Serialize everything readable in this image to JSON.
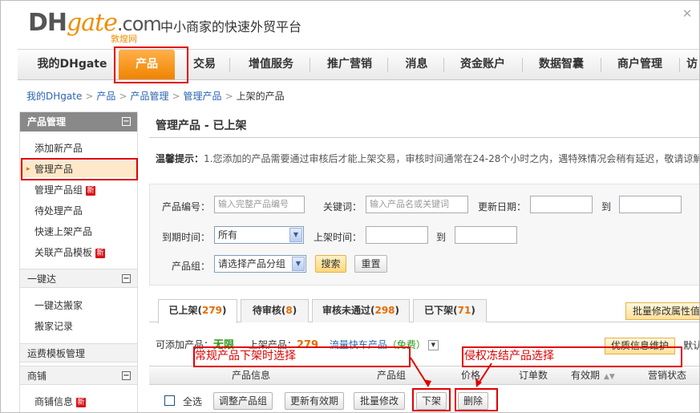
{
  "header": {
    "logo_dh": "DH",
    "logo_gate": "gate",
    "logo_com": ".com",
    "logo_sub": "敦煌网",
    "slogan": "中小商家的快速外贸平台",
    "close_symbol": "✕"
  },
  "nav": {
    "items": [
      "我的DHgate",
      "产品",
      "交易",
      "增值服务",
      "推广营销",
      "消息",
      "资金账户",
      "数据智囊",
      "商户管理",
      "访"
    ],
    "active_index": 1
  },
  "breadcrumb": {
    "items": [
      "我的DHgate",
      "产品",
      "产品管理",
      "管理产品"
    ],
    "current": "上架的产品",
    "separator": ">"
  },
  "sidebar": {
    "section1_title": "产品管理",
    "section1_items": [
      "添加新产品",
      "管理产品",
      "管理产品组",
      "待处理产品",
      "快速上架产品",
      "关联产品模板"
    ],
    "new_badge": "新",
    "section2_title": "一键达",
    "section2_items": [
      "一键达搬家",
      "搬家记录"
    ],
    "section3_title": "运费模板管理",
    "section4_title": "商铺",
    "section4_items": [
      "商铺信息"
    ],
    "toggle_minus": "−"
  },
  "main": {
    "title": "管理产品 - 已上架",
    "tip_label": "温馨提示：",
    "tip_text": "1.您添加的产品需要通过审核后才能上架交易，审核时间通常在24-28个小时之内，遇特殊情况会稍有延迟，敬请谅解"
  },
  "search": {
    "product_no_label": "产品编号：",
    "product_no_placeholder": "输入完整产品编号",
    "keyword_label": "关键词：",
    "keyword_placeholder": "输入产品名或关键词",
    "update_date_label": "更新日期：",
    "to_label": "到",
    "expire_label": "到期时间：",
    "expire_value": "所有",
    "listing_time_label": "上架时间：",
    "group_label": "产品组：",
    "group_value": "请选择产品分组",
    "search_button": "搜索",
    "reset_button": "重置",
    "dropdown_arrow": "▼"
  },
  "tabs": [
    {
      "label": "已上架",
      "count": "279"
    },
    {
      "label": "待审核",
      "count": "8"
    },
    {
      "label": "审核未通过",
      "count": "298"
    },
    {
      "label": "已下架",
      "count": "71"
    }
  ],
  "tab_paren_open": "(",
  "tab_paren_close": ")",
  "batch_attr_button": "批量修改属性值",
  "info": {
    "can_add_label": "可添加产品：",
    "can_add_value": "无限",
    "listed_label": "上架产品：",
    "listed_value": "279",
    "flow_link": "流量快车产品",
    "free_text": "（免费）",
    "maint_button": "优质信息维护",
    "default_text": "默认"
  },
  "table": {
    "headers": [
      "产品信息",
      "产品组",
      "价格",
      "订单数",
      "有效期",
      "营销状态"
    ],
    "sort_symbol": "▲▼"
  },
  "actions": {
    "select_all": "全选",
    "adjust_group": "调整产品组",
    "update_validity": "更新有效期",
    "batch_edit": "批量修改",
    "delist": "下架",
    "delete": "删除"
  },
  "annotations": {
    "delist_note": "常规产品下架时选择",
    "frozen_note": "侵权冻结产品选择"
  },
  "colors": {
    "nav_active": "#f08300",
    "annotation_red": "#e00000",
    "count_orange": "#e56c00",
    "link_blue": "#2b64b0",
    "unlimited_green": "#2b9a18"
  }
}
